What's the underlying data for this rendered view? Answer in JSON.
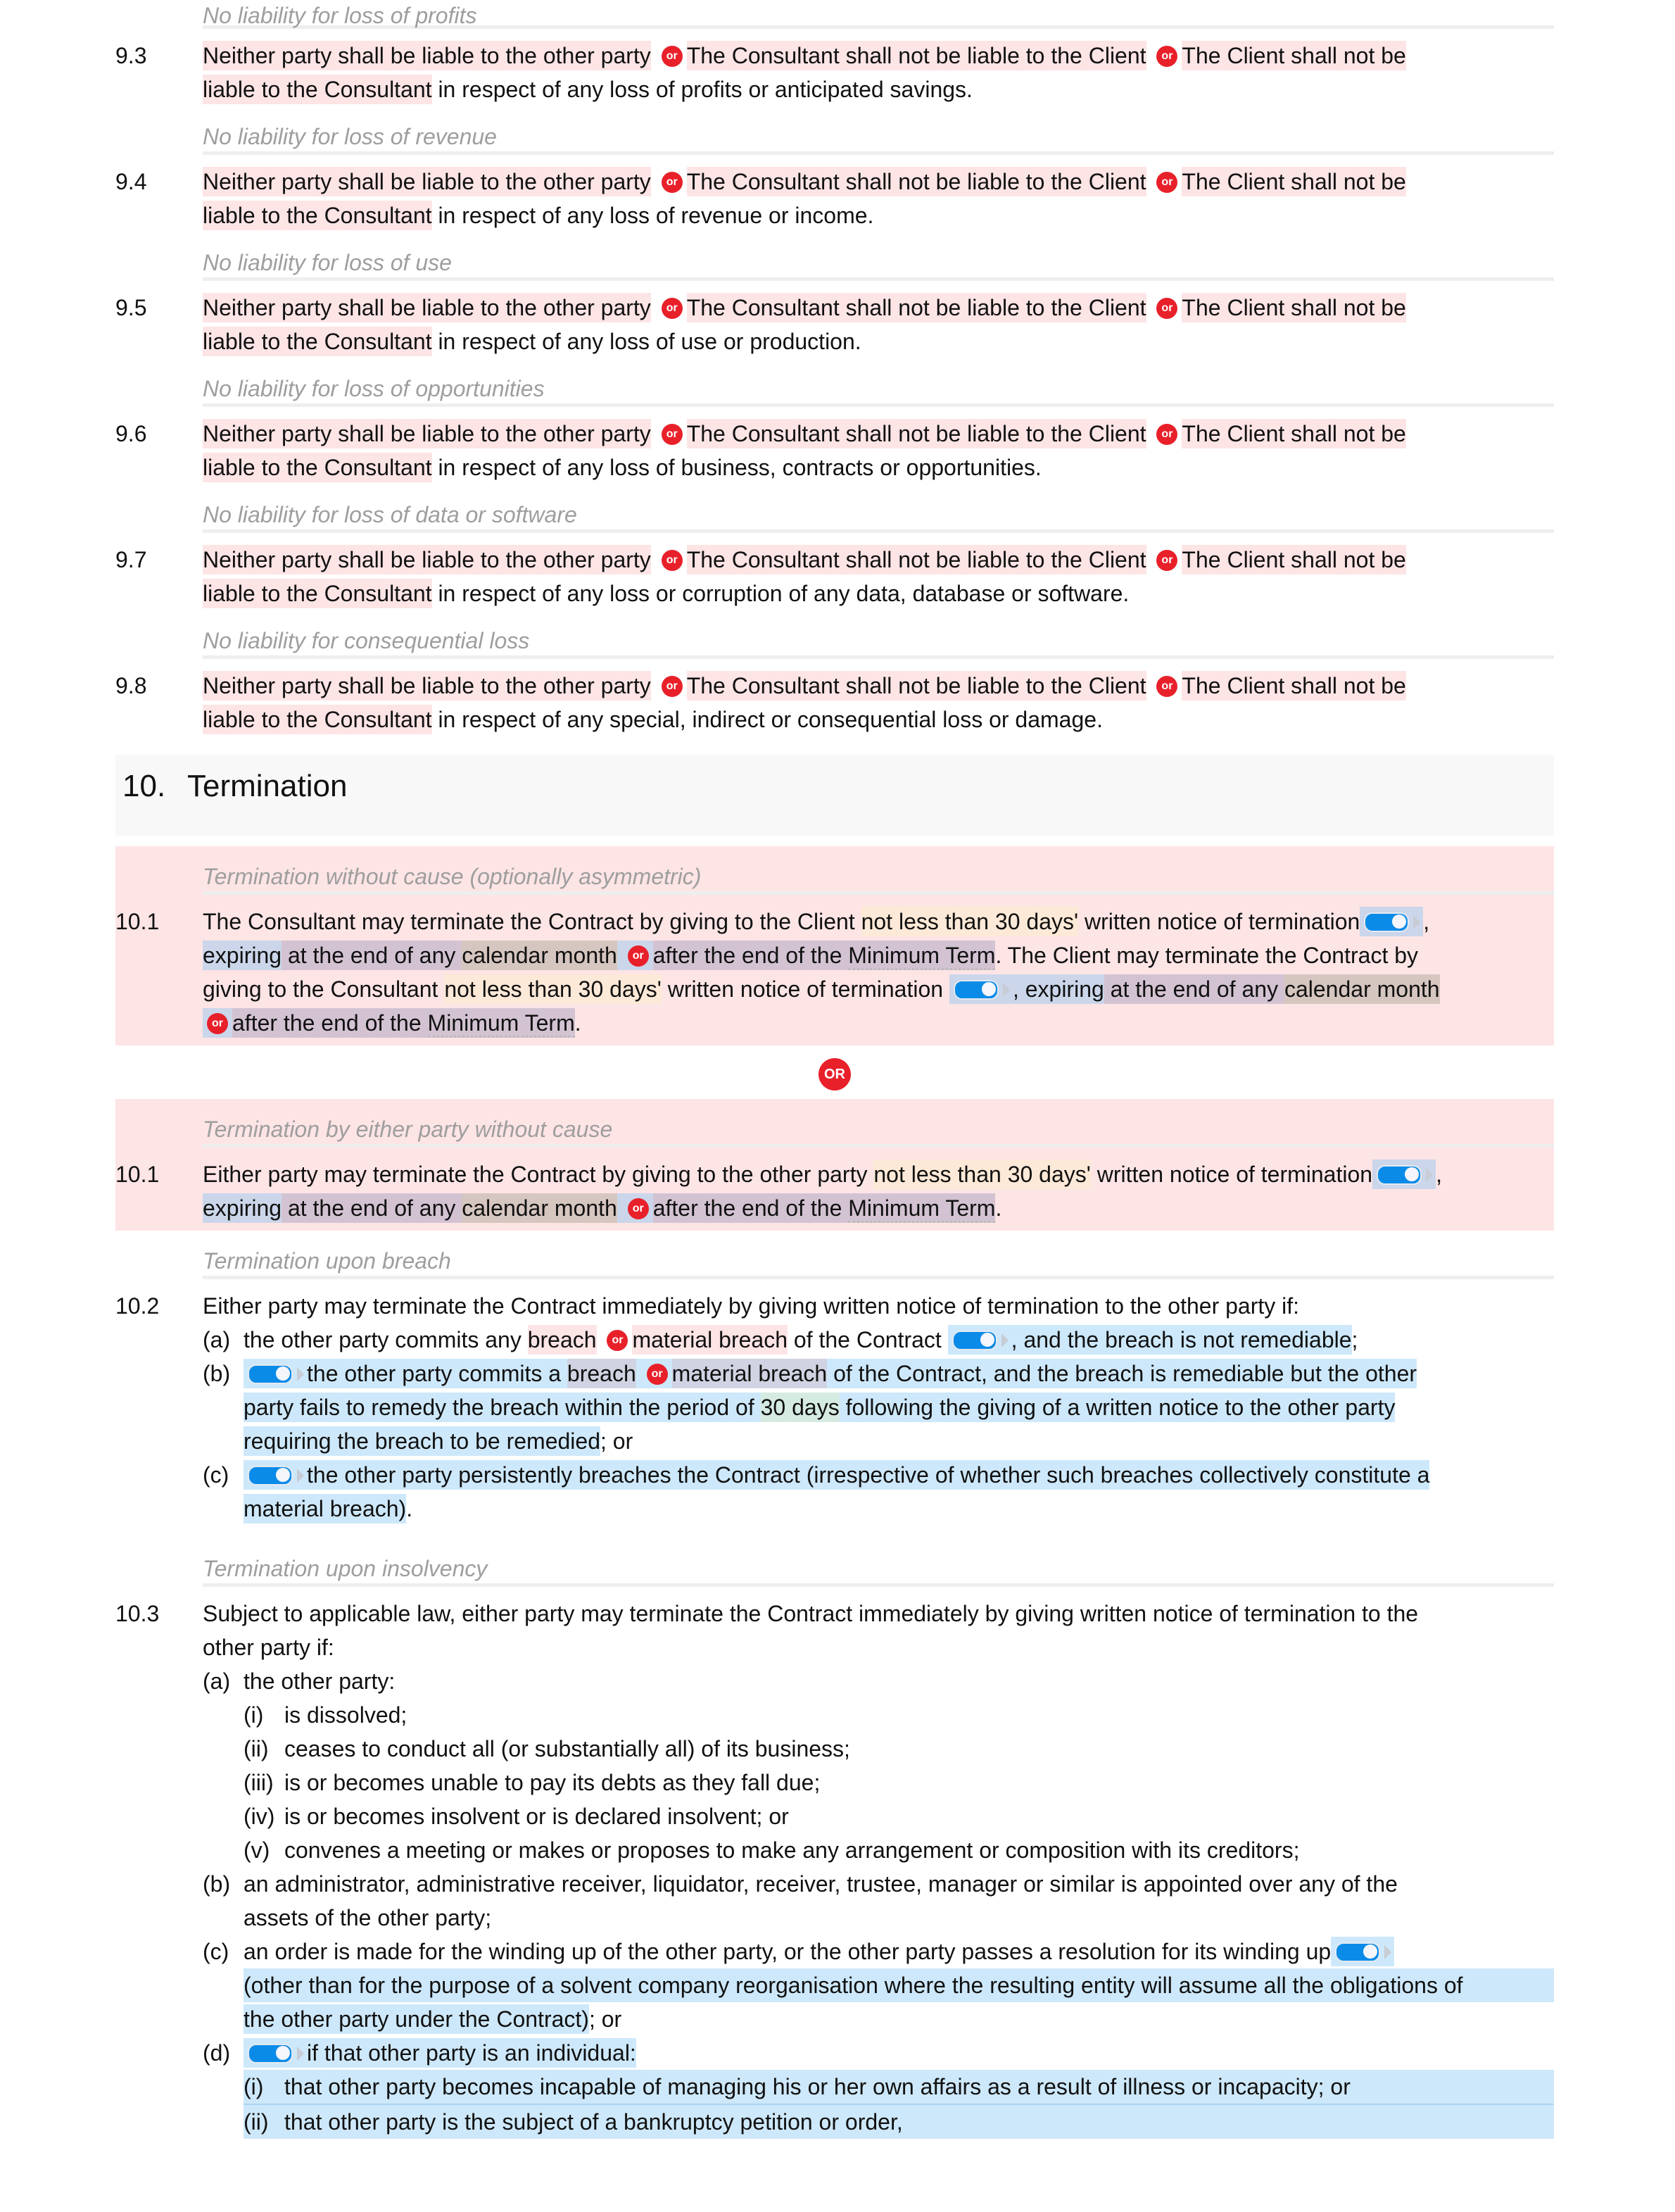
{
  "liability_clauses": [
    {
      "heading": "No liability for loss of profits",
      "number": "9.3",
      "tail": "in respect of any loss of profits or anticipated savings."
    },
    {
      "heading": "No liability for loss of revenue",
      "number": "9.4",
      "tail": "in respect of any loss of revenue or income."
    },
    {
      "heading": "No liability for loss of use",
      "number": "9.5",
      "tail": "in respect of any loss of use or production."
    },
    {
      "heading": "No liability for loss of opportunities",
      "number": "9.6",
      "tail": "in respect of any loss of business, contracts or opportunities."
    },
    {
      "heading": "No liability for loss of data or software",
      "number": "9.7",
      "tail": "in respect of any loss or corruption of any data, database or software."
    },
    {
      "heading": "No liability for consequential loss",
      "number": "9.8",
      "tail": "in respect of any special, indirect or consequential loss or damage."
    }
  ],
  "liability_options": {
    "opt1": "Neither party shall be liable to the other party",
    "opt2": "The Consultant shall not be liable to the Client",
    "opt3a": "The Client shall not be",
    "opt3b": "liable to the Consultant"
  },
  "or_small": "or",
  "or_large": "OR",
  "section": {
    "number": "10.",
    "title": "Termination"
  },
  "c101a": {
    "heading": "Termination without cause (optionally asymmetric)",
    "number": "10.1",
    "l1_a": "The Consultant may terminate the Contract by giving to the Client ",
    "notice": "not less than 30 days'",
    "l1_b": " written notice of termination",
    "comma": ",",
    "expiring": "expiring",
    "at_end": " at the end of any ",
    "calendar": "calendar month",
    "after": "after the end of the ",
    "min_term": "Minimum Term",
    "l2_b": ". The Client may terminate the Contract by",
    "l3_a": "giving to the Consultant ",
    "l3_b": " written notice of termination ",
    "l3_c": ", expiring",
    "period": "."
  },
  "c101b": {
    "heading": "Termination by either party without cause",
    "number": "10.1",
    "l1_a": "Either party may terminate the Contract by giving to the other party ",
    "notice": "not less than 30 days'",
    "l1_b": " written notice of termination",
    "comma": ",",
    "expiring": "expiring",
    "at_end": " at the end of any ",
    "calendar": "calendar month",
    "after": "after the end of the ",
    "min_term": "Minimum Term",
    "period": "."
  },
  "c102": {
    "heading": "Termination upon breach",
    "number": "10.2",
    "intro": "Either party may terminate the Contract immediately by giving written notice of termination to the other party if:",
    "a_label": "(a)",
    "a_1": "the other party commits any ",
    "breach": "breach",
    "material": "material breach",
    "a_2": " of the Contract ",
    "a_3": ", and the breach is not remediable",
    "a_4": ";",
    "b_label": "(b)",
    "b_1": "the other party commits a ",
    "b_2": " of the Contract, and the breach is remediable but the other",
    "b_3": "party fails to remedy the breach within the period of ",
    "days": "30 days",
    "b_4": " following the giving of a written notice to the other party",
    "b_5": "requiring the breach to be remedied",
    "b_6": "; or",
    "c_label": "(c)",
    "c_1": "the other party persistently breaches the Contract (irrespective of whether such breaches collectively constitute a",
    "c_2": "material breach)",
    "c_3": "."
  },
  "c103": {
    "heading": "Termination upon insolvency",
    "number": "10.3",
    "intro1": "Subject to applicable law, either party may terminate the Contract immediately by giving written notice of termination to the",
    "intro2": "other party if:",
    "a_label": "(a)",
    "a_text": "the other party:",
    "a_items": [
      {
        "label": "(i)",
        "text": "is dissolved;"
      },
      {
        "label": "(ii)",
        "text": "ceases to conduct all (or substantially all) of its business;"
      },
      {
        "label": "(iii)",
        "text": "is or becomes unable to pay its debts as they fall due;"
      },
      {
        "label": "(iv)",
        "text": "is or becomes insolvent or is declared insolvent; or"
      },
      {
        "label": "(v)",
        "text": "convenes a meeting or makes or proposes to make any arrangement or composition with its creditors;"
      }
    ],
    "b_label": "(b)",
    "b_1": "an administrator, administrative receiver, liquidator, receiver, trustee, manager or similar is appointed over any of the",
    "b_2": "assets of the other party;",
    "c_label": "(c)",
    "c_1": "an order is made for the winding up of the other party, or the other party passes a resolution for its winding up",
    "c_2": "(other than for the purpose of a solvent company reorganisation where the resulting entity will assume all the obligations of",
    "c_3": "the other party under the Contract)",
    "c_4": "; or",
    "d_label": "(d)",
    "d_text": "if that other party is an individual:",
    "d_items": [
      {
        "label": "(i)",
        "text": "that other party becomes incapable of managing his or her own affairs as a result of illness or incapacity; or"
      },
      {
        "label": "(ii)",
        "text": "that other party is the subject of a bankruptcy petition or order,"
      }
    ]
  }
}
